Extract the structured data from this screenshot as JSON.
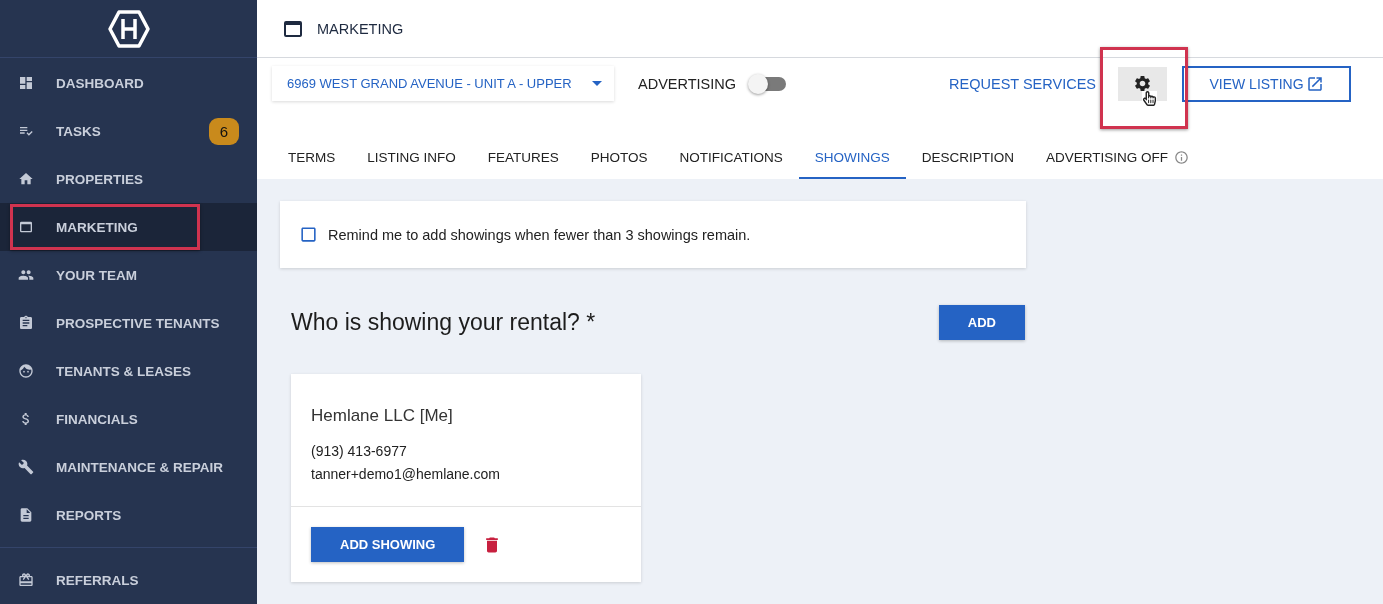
{
  "sidebar": {
    "items": [
      {
        "label": "DASHBOARD",
        "selected": false,
        "highlighted": false
      },
      {
        "label": "TASKS",
        "selected": false,
        "highlighted": false,
        "badge": "6"
      },
      {
        "label": "PROPERTIES",
        "selected": false,
        "highlighted": false
      },
      {
        "label": "MARKETING",
        "selected": true,
        "highlighted": true
      },
      {
        "label": "YOUR TEAM",
        "selected": false,
        "highlighted": false
      },
      {
        "label": "PROSPECTIVE TENANTS",
        "selected": false,
        "highlighted": false
      },
      {
        "label": "TENANTS & LEASES",
        "selected": false,
        "highlighted": false
      },
      {
        "label": "FINANCIALS",
        "selected": false,
        "highlighted": false
      },
      {
        "label": "MAINTENANCE & REPAIR",
        "selected": false,
        "highlighted": false
      },
      {
        "label": "REPORTS",
        "selected": false,
        "highlighted": false
      }
    ],
    "footer_items": [
      {
        "label": "REFERRALS",
        "selected": false,
        "highlighted": false
      }
    ]
  },
  "header": {
    "title": "MARKETING"
  },
  "toolbar": {
    "property_select": {
      "value": "6969 WEST GRAND AVENUE - UNIT A - UPPER"
    },
    "advertising": {
      "label": "ADVERTISING",
      "on": false
    },
    "request_services": "REQUEST SERVICES",
    "settings_button": {
      "highlighted": true
    },
    "view_listing": "VIEW LISTING"
  },
  "tabs": [
    {
      "label": "TERMS",
      "selected": false
    },
    {
      "label": "LISTING INFO",
      "selected": false
    },
    {
      "label": "FEATURES",
      "selected": false
    },
    {
      "label": "PHOTOS",
      "selected": false
    },
    {
      "label": "NOTIFICATIONS",
      "selected": false
    },
    {
      "label": "SHOWINGS",
      "selected": true
    },
    {
      "label": "DESCRIPTION",
      "selected": false
    },
    {
      "label": "ADVERTISING OFF",
      "selected": false,
      "info": true
    }
  ],
  "reminder": {
    "checked": false,
    "label": "Remind me to add showings when fewer than 3 showings remain."
  },
  "showings": {
    "heading": "Who is showing your rental? *",
    "add_button": "ADD",
    "agents": [
      {
        "name": "Hemlane LLC [Me]",
        "phone": "(913) 413-6977",
        "email": "tanner+demo1@hemlane.com",
        "button": "ADD SHOWING"
      }
    ]
  }
}
